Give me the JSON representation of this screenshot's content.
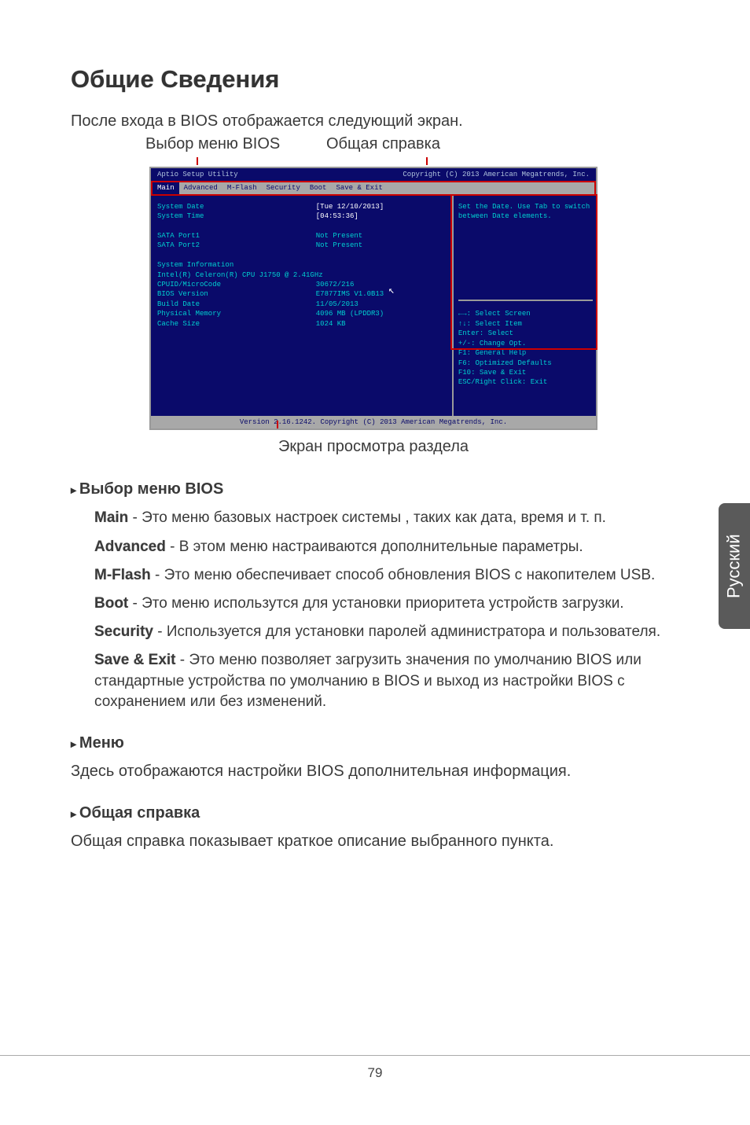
{
  "title": "Общие Сведения",
  "intro": "После входа в BIOS отображается следующий экран.",
  "callout_menu": "Выбор меню BIOS",
  "callout_help": "Общая справка",
  "screenview_label": "Экран просмотра раздела",
  "bios": {
    "top_left": "Aptio Setup Utility",
    "top_right": "  Copyright (C) 2013 American Megatrends, Inc.",
    "tabs": [
      "Main",
      "Advanced",
      "M-Flash",
      "Security",
      "Boot",
      "Save & Exit"
    ],
    "left_rows": [
      {
        "k": "System Date",
        "v": "[Tue 12/10/2013]"
      },
      {
        "k": "System Time",
        "v": "[04:53:36]"
      },
      {
        "k": "",
        "v": ""
      },
      {
        "k": "SATA Port1",
        "v": "Not Present"
      },
      {
        "k": "SATA Port2",
        "v": "Not Present"
      },
      {
        "k": "",
        "v": ""
      },
      {
        "k": "System Information",
        "v": ""
      },
      {
        "k": "Intel(R) Celeron(R) CPU J1750 @ 2.41GHz",
        "v": ""
      },
      {
        "k": "CPUID/MicroCode",
        "v": "30672/216"
      },
      {
        "k": "BIOS Version",
        "v": "E7877IMS V1.0B13"
      },
      {
        "k": "Build Date",
        "v": "11/05/2013"
      },
      {
        "k": "Physical Memory",
        "v": "4096 MB (LPDDR3)"
      },
      {
        "k": "Cache Size",
        "v": "1024 KB"
      }
    ],
    "help_top": "Set the Date. Use Tab to switch between Date elements.",
    "help_bot": [
      "←→: Select Screen",
      "↑↓: Select Item",
      "Enter: Select",
      "+/-: Change Opt.",
      "F1: General Help",
      "F6: Optimized Defaults",
      "F10: Save & Exit",
      "ESC/Right Click: Exit"
    ],
    "footer": "Version 2.16.1242. Copyright (C) 2013 American Megatrends, Inc."
  },
  "sec1_head": "Выбор меню BIOS",
  "sec1_items": [
    {
      "label": "Main",
      "text": " - Это меню базовых настроек системы , таких как дата, время и т. п."
    },
    {
      "label": "Advanced",
      "text": " - В этом меню настраиваются дополнительные параметры."
    },
    {
      "label": "M-Flash",
      "text": " - Это меню обеспечивает способ обновления BIOS с накопителем USB."
    },
    {
      "label": "Boot",
      "text": " - Это меню использутся для установки приоритета устройств загрузки."
    },
    {
      "label": "Security",
      "text": " - Используется для установки паролей администратора и пользователя."
    },
    {
      "label": "Save & Exit",
      "text": " - Это меню позволяет загрузить значения по умолчанию BIOS или стандартные устройства по умолчанию в BIOS и выход из настройки BIOS с сохранением или без изменений."
    }
  ],
  "sec2_head": "Меню",
  "sec2_text": "Здесь отображаются настройки BIOS дополнительная информация.",
  "sec3_head": "Общая справка",
  "sec3_text": "Общая справка показывает краткое описание выбранного пункта.",
  "side_tab": "Русский",
  "page_num": "79"
}
